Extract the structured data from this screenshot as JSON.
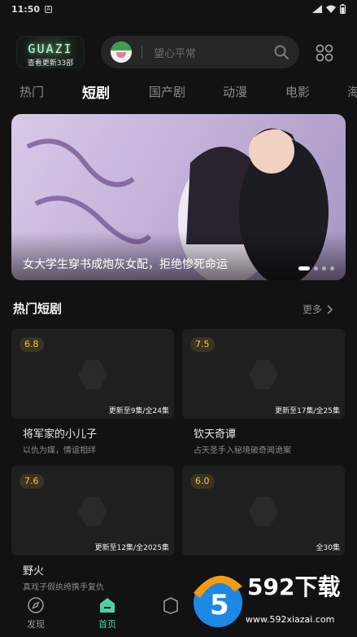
{
  "status_bar": {
    "time": "11:50"
  },
  "header": {
    "logo_text": "GUAZI",
    "logo_subtitle": "查看更新33部",
    "search_placeholder": "望心平常"
  },
  "tabs": [
    "热门",
    "短剧",
    "国产剧",
    "动漫",
    "电影",
    "海"
  ],
  "active_tab": "短剧",
  "banner": {
    "caption": "女大学生穿书成炮灰女配，拒绝惨死命运",
    "page_count": 4,
    "active_page": 1
  },
  "section": {
    "title": "热门短剧",
    "more_label": "更多"
  },
  "cards": [
    {
      "rating": "6.8",
      "progress": "更新至9集/全24集",
      "title": "将军家的小儿子",
      "desc": "以仇为媒，情谊相绊"
    },
    {
      "rating": "7.5",
      "progress": "更新至17集/全25集",
      "title": "钦天奇谭",
      "desc": "占天圣手入秘境破奇闻诡案"
    },
    {
      "rating": "7.6",
      "progress": "更新至12集/全2025集",
      "title": "野火",
      "desc": "真戏子假纨绔携手复仇"
    },
    {
      "rating": "6.0",
      "progress": "全30集",
      "title": "",
      "desc": ""
    }
  ],
  "bottom_nav": [
    {
      "label": "发现",
      "icon": "compass-icon"
    },
    {
      "label": "首页",
      "icon": "home-icon"
    },
    {
      "label": "",
      "icon": "box-icon"
    }
  ],
  "watermark": {
    "brand": "592下载",
    "url": "www.592xiazai.com"
  },
  "colors": {
    "accent": "#4fd1a8",
    "rating_text": "#f4c542",
    "background": "#121212"
  }
}
